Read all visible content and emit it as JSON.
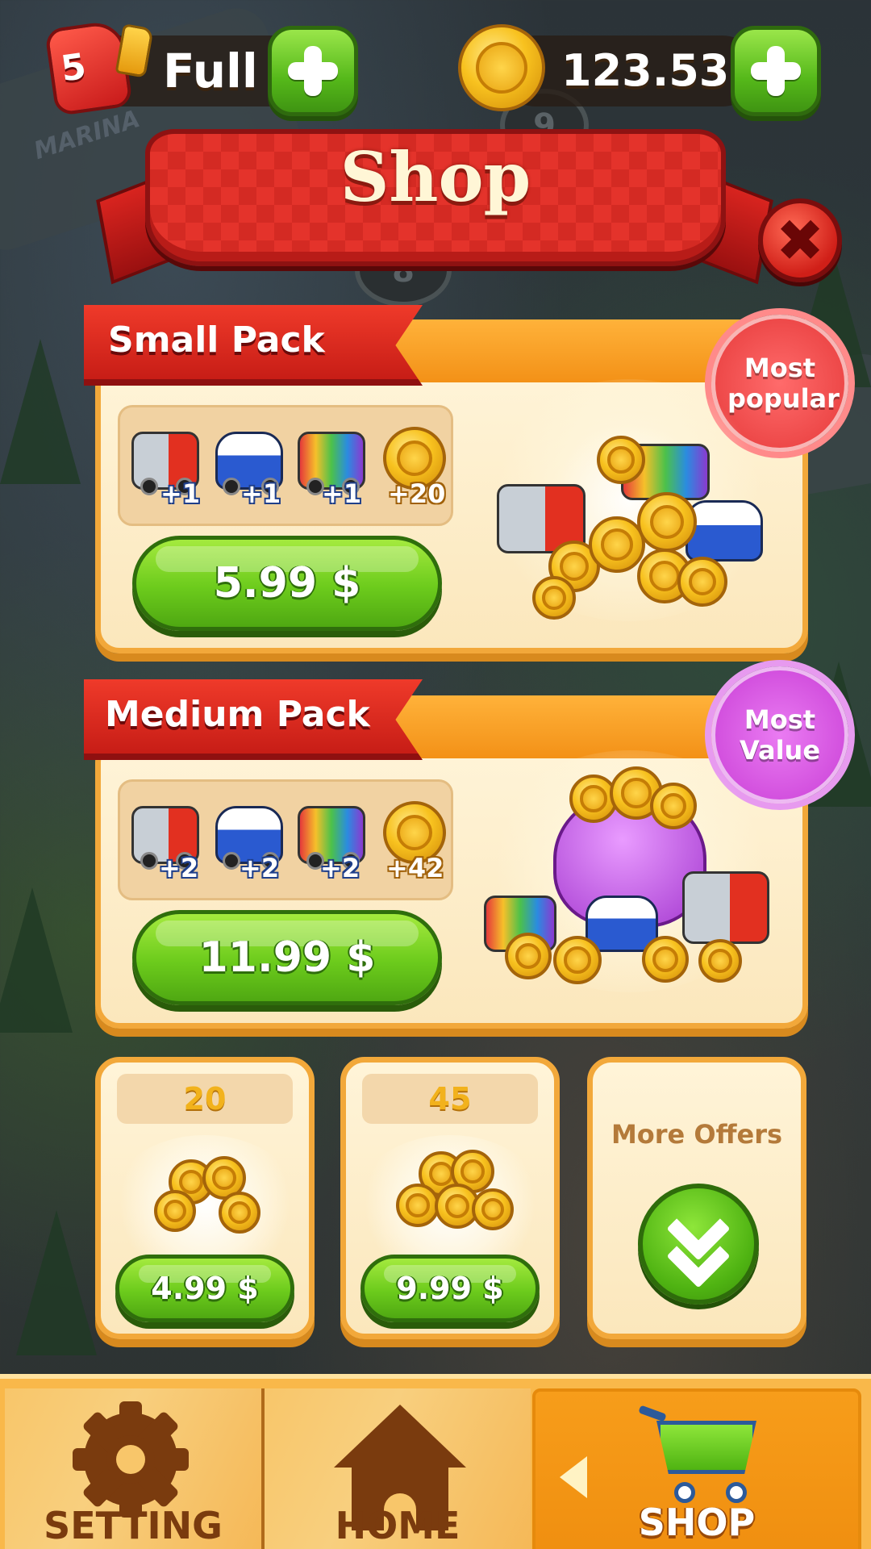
{
  "top_bar": {
    "fuel": {
      "count": "5",
      "status": "Full",
      "icon": "fuel-can-icon"
    },
    "coins": {
      "amount": "123.530",
      "icon": "coin-icon"
    },
    "add_icon": "plus-icon"
  },
  "header": {
    "title": "Shop",
    "close_icon": "close-icon"
  },
  "packs": [
    {
      "name": "Small Pack",
      "badge": "Most popular",
      "badge_color": "#e63a3a",
      "items": [
        {
          "icon": "tow-truck-icon",
          "qty": "+1"
        },
        {
          "icon": "police-car-icon",
          "qty": "+1"
        },
        {
          "icon": "rainbow-bus-icon",
          "qty": "+1"
        },
        {
          "icon": "coin-icon",
          "qty": "+20"
        }
      ],
      "price": "5.99 $"
    },
    {
      "name": "Medium Pack",
      "badge": "Most Value",
      "badge_color": "#c93fd6",
      "items": [
        {
          "icon": "tow-truck-icon",
          "qty": "+2"
        },
        {
          "icon": "police-car-icon",
          "qty": "+2"
        },
        {
          "icon": "rainbow-bus-icon",
          "qty": "+2"
        },
        {
          "icon": "coin-icon",
          "qty": "+42"
        }
      ],
      "price": "11.99 $"
    }
  ],
  "coin_offers": [
    {
      "amount": "20",
      "price": "4.99 $"
    },
    {
      "amount": "45",
      "price": "9.99 $"
    }
  ],
  "more_offers": {
    "label": "More Offers",
    "icon": "chevron-double-down-icon"
  },
  "nav": {
    "items": [
      {
        "label": "SETTING",
        "icon": "gear-icon",
        "active": false
      },
      {
        "label": "HOME",
        "icon": "home-icon",
        "active": false
      },
      {
        "label": "SHOP",
        "icon": "cart-icon",
        "active": true
      }
    ]
  },
  "background": {
    "sign_text": "MARINA",
    "marker_1": "9",
    "marker_2": "8"
  },
  "colors": {
    "primary_green": "#6ccb1c",
    "ribbon_red": "#e4332b",
    "card_border": "#f2a83a",
    "nav_bg": "#f9b84a"
  }
}
